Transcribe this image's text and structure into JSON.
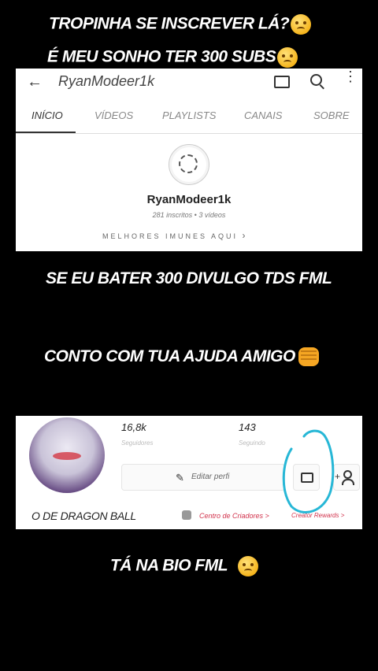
{
  "captions": {
    "top_line_1": "TROPINHA SE INSCREVER LÁ?",
    "top_line_2": "É MEU SONHO TER 300 SUBS",
    "mid_line_1": "SE EU BATER 300 DIVULGO TDS FML",
    "mid_line_2": "CONTO COM TUA AJUDA AMIGO",
    "bottom_line": "TÁ NA BIO FML"
  },
  "emojis": {
    "pleading": "pleading-face-emoji",
    "pensive": "pensive-face-emoji",
    "fist": "oncoming-fist-emoji"
  },
  "youtube": {
    "title": "RyanModeer1k",
    "tabs": [
      "INÍCIO",
      "VÍDEOS",
      "PLAYLISTS",
      "CANAIS",
      "SOBRE"
    ],
    "active_tab": "INÍCIO",
    "channel_name": "RyanModeer1k",
    "meta": "281 inscritos • 3 vídeos",
    "motto": "MELHORES IMUNES AQUI",
    "icons": [
      "back-arrow-icon",
      "cast-icon",
      "search-icon",
      "more-vert-icon",
      "chevron-right-icon"
    ]
  },
  "tiktok": {
    "stats": [
      {
        "value": "16,8k",
        "label": "Seguidores"
      },
      {
        "value": "143",
        "label": "Seguindo"
      }
    ],
    "edit_label": "Editar perfi",
    "bio": "O DE DRAGON BALL",
    "creator_center": "Centro de Criadores >",
    "creator_rewards": "Creator Rewards >",
    "highlight_color": "#27b7d6"
  }
}
